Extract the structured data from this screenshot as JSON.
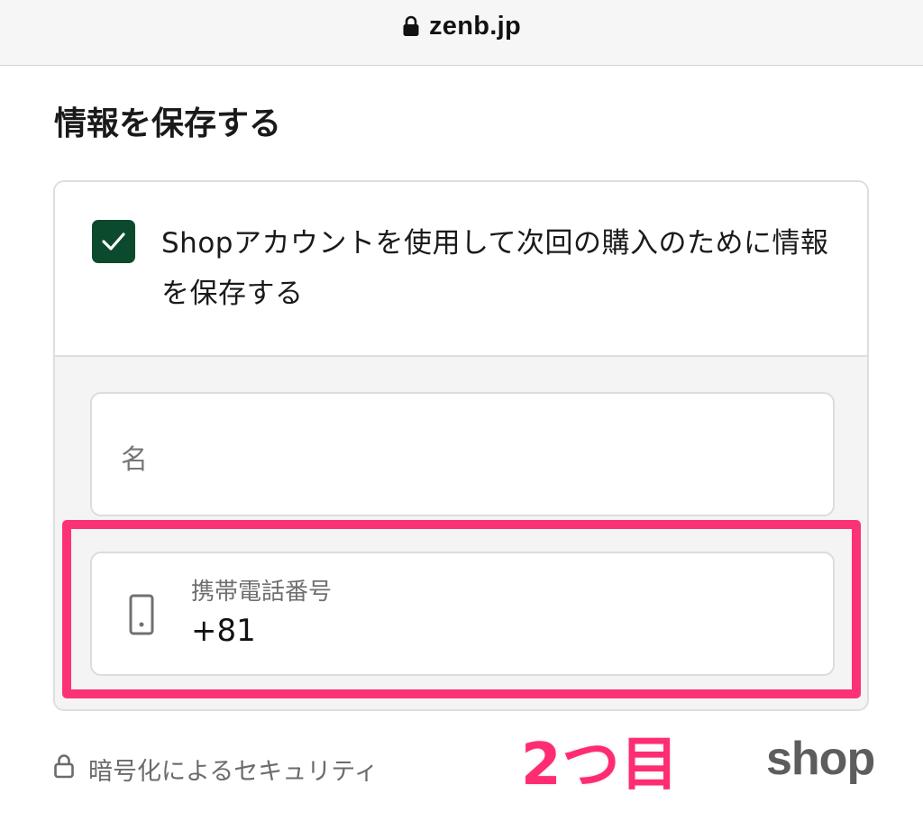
{
  "browser": {
    "url": "zenb.jp",
    "lock_icon": "lock-icon"
  },
  "section": {
    "title": "情報を保存する"
  },
  "save_card": {
    "checkbox": {
      "checked": true,
      "color": "#0b4a2c",
      "label": "Shopアカウントを使用して次回の購入のために情報を保存する"
    },
    "name_field": {
      "placeholder": "名",
      "value": ""
    },
    "phone_field": {
      "icon": "mobile-phone-icon",
      "label": "携帯電話番号",
      "value": "+81"
    }
  },
  "annotation": {
    "text": "2つ目",
    "color": "#fb3275"
  },
  "footer": {
    "security_icon": "lock-icon",
    "security_text": "暗号化によるセキュリティ",
    "logo_text": "shop"
  }
}
